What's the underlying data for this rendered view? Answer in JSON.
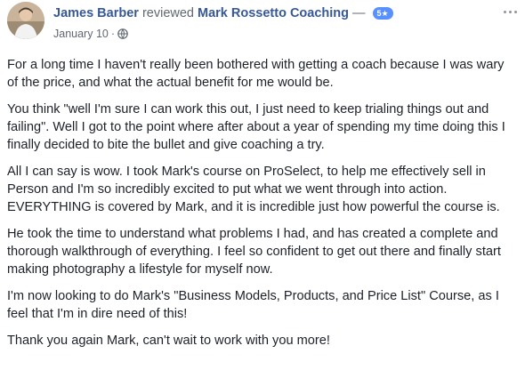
{
  "post": {
    "author": "James Barber",
    "verb": "reviewed",
    "page": "Mark Rossetto Coaching",
    "dash": "—",
    "rating": "5★",
    "date": "January 10",
    "separator": "·",
    "privacy_icon": "globe-icon",
    "more_icon": "more-options-icon",
    "paragraphs": [
      "For a long time I haven't really been bothered with getting a coach because I was wary of the price, and what the actual benefit for me would be.",
      "You think \"well I'm sure I can work this out, I just need to keep trialing things out and failing\". Well I got to the point where after about a year of spending my time doing this I finally decided to bite the bullet and give coaching a try.",
      "All I can say is wow. I took Mark's course on ProSelect, to help me effectively sell in Person and I'm so incredibly excited to put what we went through into action. EVERYTHING is covered by Mark, and it is incredible just how powerful the course is.",
      "He took the time to understand what problems I had, and has created a complete and thorough walkthrough of everything. I feel so confident to get out there and finally start making photography a lifestyle for myself now.",
      "I'm now looking to do Mark's \"Business Models, Products, and Price List\" Course, as I feel that I'm in dire need of this!",
      "Thank you again Mark, can't wait to work with you more!"
    ]
  },
  "colors": {
    "link": "#365899",
    "meta": "#616770",
    "text": "#1d2129",
    "badge": "#5890ff"
  }
}
